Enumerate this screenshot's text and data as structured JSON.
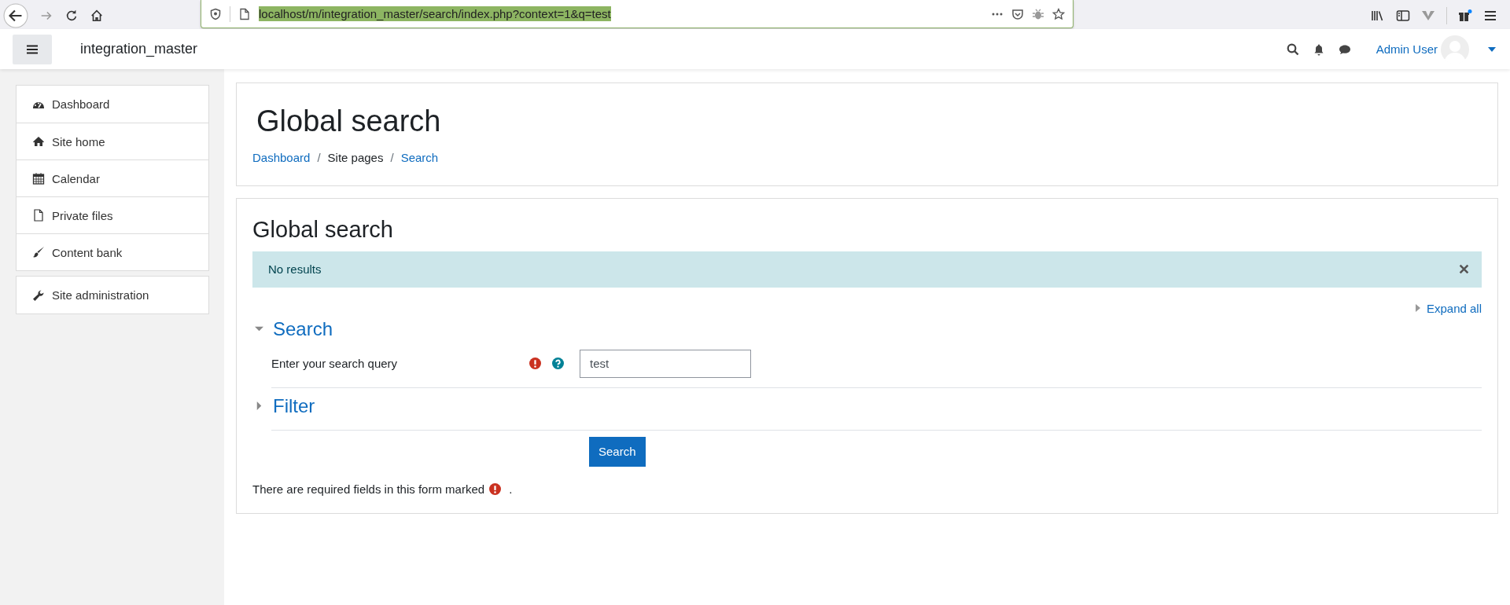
{
  "browser": {
    "url": "localhost/m/integration_master/search/index.php?context=1&q=test"
  },
  "header": {
    "site_name": "integration_master",
    "user_name": "Admin User"
  },
  "sidebar": {
    "groups": [
      {
        "items": [
          {
            "label": "Dashboard",
            "kind": "dashboard"
          },
          {
            "label": "Site home",
            "kind": "home"
          },
          {
            "label": "Calendar",
            "kind": "calendar"
          },
          {
            "label": "Private files",
            "kind": "file"
          },
          {
            "label": "Content bank",
            "kind": "brush"
          }
        ]
      },
      {
        "items": [
          {
            "label": "Site administration",
            "kind": "wrench"
          }
        ]
      }
    ]
  },
  "page_header": {
    "title": "Global search",
    "separator": "/",
    "breadcrumb": [
      {
        "label": "Dashboard",
        "link": true
      },
      {
        "label": "Site pages",
        "link": false
      },
      {
        "label": "Search",
        "link": true
      }
    ]
  },
  "main": {
    "heading": "Global search",
    "alert": {
      "message": "No results",
      "dismissible": true
    },
    "expand_all": "Expand all",
    "sections": [
      {
        "title": "Search",
        "expanded": true,
        "fields": [
          {
            "label": "Enter your search query",
            "required": true,
            "help": true,
            "value": "test"
          }
        ]
      },
      {
        "title": "Filter",
        "expanded": false
      }
    ],
    "submit": "Search",
    "required_note": {
      "before": "There are required fields in this form marked",
      "after": "."
    }
  }
}
